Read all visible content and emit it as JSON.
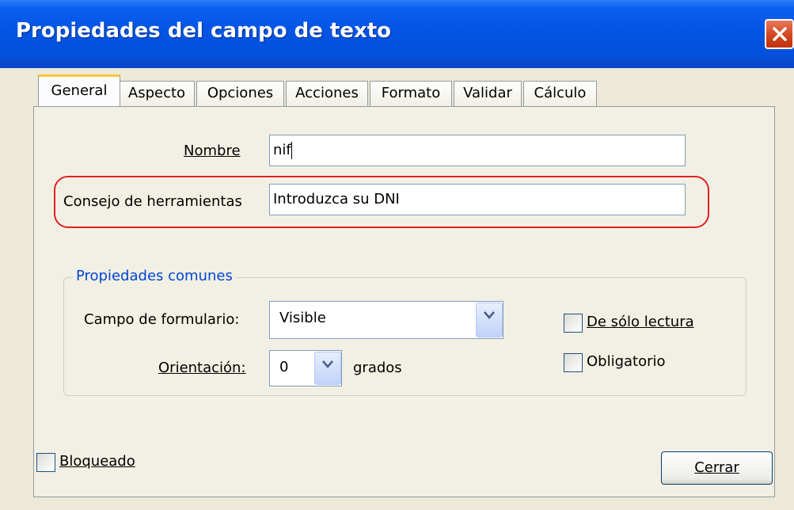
{
  "window": {
    "title": "Propiedades del campo de texto"
  },
  "tabs": [
    {
      "label": "General",
      "active": true
    },
    {
      "label": "Aspecto"
    },
    {
      "label": "Opciones"
    },
    {
      "label": "Acciones"
    },
    {
      "label": "Formato"
    },
    {
      "label": "Validar"
    },
    {
      "label": "Cálculo"
    }
  ],
  "general": {
    "name_label": "Nombre",
    "name_value": "nif",
    "tooltip_label": "Consejo de herramientas",
    "tooltip_value": "Introduzca su DNI"
  },
  "common": {
    "group_title": "Propiedades comunes",
    "form_field_label": "Campo de formulario:",
    "form_field_value": "Visible",
    "orientation_label": "Orientación:",
    "orientation_value": "0",
    "degrees_label": "grados",
    "readonly_label": "De sólo lectura",
    "readonly_checked": false,
    "required_label": "Obligatorio",
    "required_checked": false
  },
  "footer": {
    "locked_label": "Bloqueado",
    "locked_checked": false,
    "close_label": "Cerrar"
  },
  "icons": {
    "close": "close-icon",
    "dropdown": "chevron-down-icon"
  },
  "colors": {
    "titlebar": "#0453e5",
    "dialog_bg": "#ece9d8",
    "panel_bg": "#f2f0e4",
    "highlight": "#e02020",
    "group_title": "#0046d5",
    "tab_accent": "#ffc83c"
  }
}
